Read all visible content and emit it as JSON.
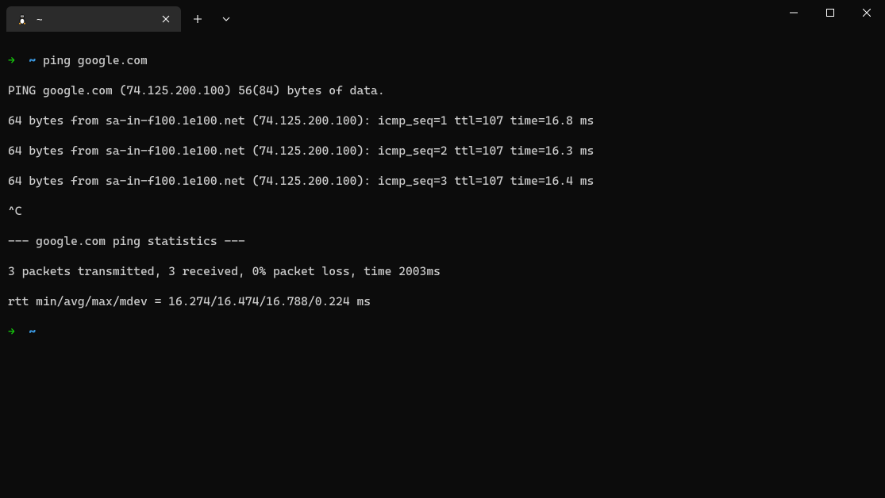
{
  "tab": {
    "title": "~"
  },
  "prompt1": {
    "arrow": "→",
    "path": "~",
    "cmd": "ping google.com"
  },
  "output": {
    "l1": "PING google.com (74.125.200.100) 56(84) bytes of data.",
    "l2": "64 bytes from sa-in-f100.1e100.net (74.125.200.100): icmp_seq=1 ttl=107 time=16.8 ms",
    "l3": "64 bytes from sa-in-f100.1e100.net (74.125.200.100): icmp_seq=2 ttl=107 time=16.3 ms",
    "l4": "64 bytes from sa-in-f100.1e100.net (74.125.200.100): icmp_seq=3 ttl=107 time=16.4 ms",
    "l5": "^C",
    "l6": "--- google.com ping statistics ---",
    "l7": "3 packets transmitted, 3 received, 0% packet loss, time 2003ms",
    "l8": "rtt min/avg/max/mdev = 16.274/16.474/16.788/0.224 ms"
  },
  "prompt2": {
    "arrow": "→",
    "path": "~"
  }
}
